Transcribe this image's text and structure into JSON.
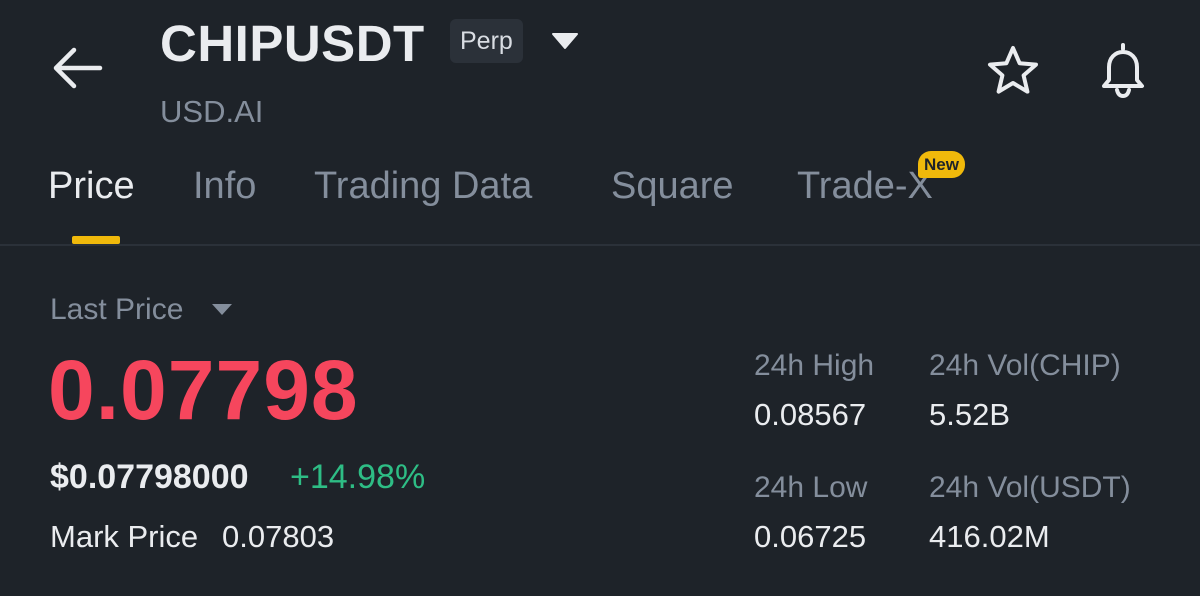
{
  "header": {
    "symbol": "CHIPUSDT",
    "contract_type": "Perp",
    "subtitle": "USD.AI",
    "icons": {
      "back": "back-arrow-icon",
      "dropdown": "caret-down-icon",
      "favorite": "star-icon",
      "alerts": "bell-icon"
    }
  },
  "tabs": [
    {
      "label": "Price",
      "active": true
    },
    {
      "label": "Info",
      "active": false
    },
    {
      "label": "Trading Data",
      "active": false
    },
    {
      "label": "Square",
      "active": false
    },
    {
      "label": "Trade-X",
      "active": false,
      "badge": "New"
    }
  ],
  "price": {
    "last_price_label": "Last Price",
    "last_price": "0.07798",
    "usd_price": "$0.07798000",
    "change_pct": "+14.98%",
    "mark_price_label": "Mark Price",
    "mark_price": "0.07803"
  },
  "stats": {
    "high_label": "24h High",
    "high_value": "0.08567",
    "low_label": "24h Low",
    "low_value": "0.06725",
    "vol_base_label": "24h Vol(CHIP)",
    "vol_base_value": "5.52B",
    "vol_quote_label": "24h Vol(USDT)",
    "vol_quote_value": "416.02M"
  },
  "colors": {
    "background": "#1e2329",
    "accent": "#f0b90b",
    "down": "#f6465d",
    "up": "#2ebd85",
    "muted": "#848e9c",
    "text": "#eaecef"
  }
}
